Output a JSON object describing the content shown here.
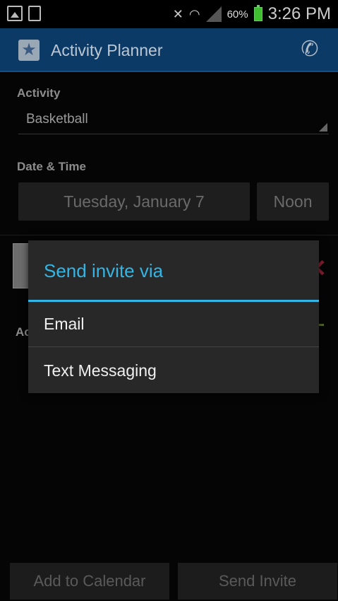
{
  "status_bar": {
    "icons": [
      "image-icon",
      "storage-icon",
      "mute-icon",
      "wifi-icon",
      "signal-icon",
      "battery-icon"
    ],
    "battery_pct": "60%",
    "time": "3:26 PM"
  },
  "action_bar": {
    "title": "Activity Planner",
    "app_icon": "star-icon",
    "phone_icon": "phone-icon"
  },
  "form": {
    "activity_label": "Activity",
    "activity_value": "Basketball",
    "datetime_label": "Date & Time",
    "date_value": "Tuesday, January 7",
    "time_value": "Noon",
    "attendees_label_partial": "Ac"
  },
  "bottom": {
    "add_calendar_label": "Add to Calendar",
    "send_invite_label": "Send Invite"
  },
  "dialog": {
    "title": "Send invite via",
    "options": [
      {
        "label": "Email"
      },
      {
        "label": "Text Messaging"
      }
    ]
  },
  "colors": {
    "accent": "#33b5e5",
    "action_bar": "#0b3a66",
    "remove": "#8a1f34"
  }
}
